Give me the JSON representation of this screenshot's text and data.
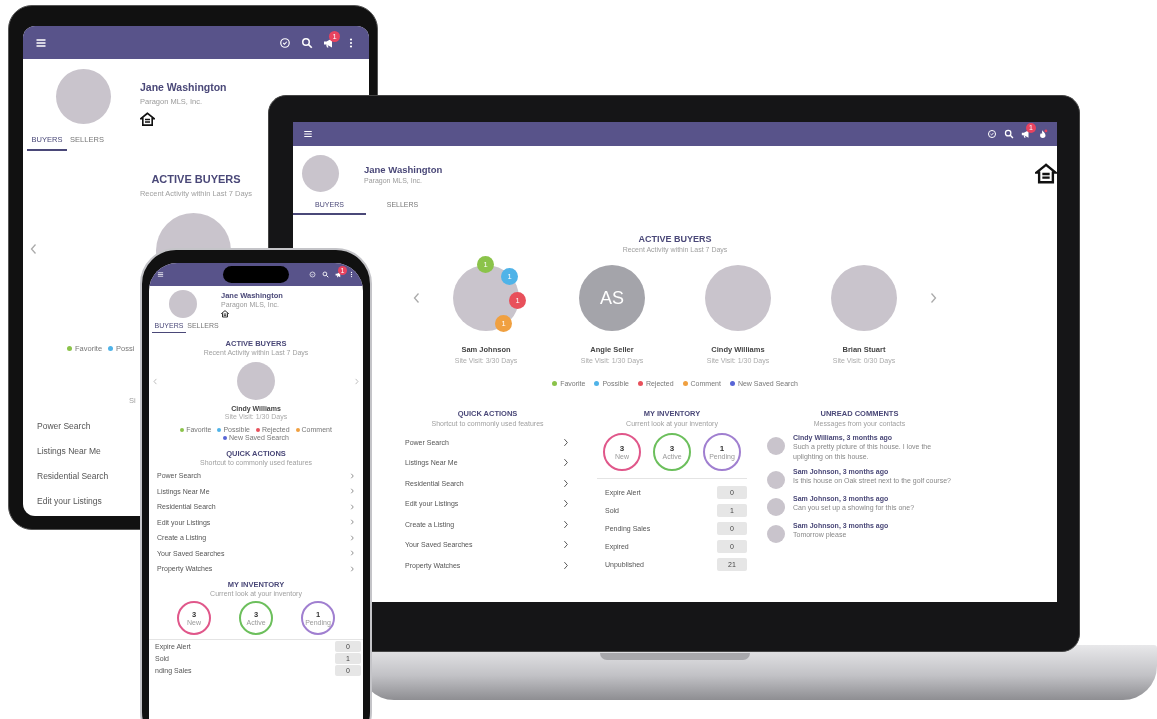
{
  "tablet": {
    "header": {
      "badge": "1"
    },
    "profile": {
      "name": "Jane Washington",
      "company": "Paragon MLS, Inc."
    },
    "tabs": [
      {
        "label": "BUYERS",
        "selected": true
      },
      {
        "label": "SELLERS",
        "selected": false
      }
    ],
    "active_buyers": {
      "title": "ACTIVE BUYERS",
      "subtitle": "Recent Activity within Last 7 Days"
    },
    "buyers": [
      {
        "kind": "photo"
      }
    ],
    "legend": [
      {
        "label": "Favorite",
        "color": "#8bc34a"
      },
      {
        "label": "Possi",
        "color": "#4fb3e8"
      }
    ],
    "quick_actions": {
      "subtitle": "Si",
      "items": [
        "Power Search",
        "Listings Near Me",
        "Residential Search",
        "Edit your Listings"
      ]
    }
  },
  "laptop": {
    "header": {
      "badge": "1"
    },
    "profile": {
      "name": "Jane Washington",
      "company": "Paragon MLS, Inc."
    },
    "tabs": [
      {
        "label": "BUYERS",
        "selected": true
      },
      {
        "label": "SELLERS",
        "selected": false
      }
    ],
    "active_buyers": {
      "title": "ACTIVE BUYERS",
      "subtitle": "Recent Activity within Last 7 Days"
    },
    "buyers": [
      {
        "kind": "photo",
        "name": "Sam Johnson",
        "visit": "Site Visit: 3/30 Days",
        "counts": [
          {
            "value": "1",
            "color": "#8bc34a"
          },
          {
            "value": "1",
            "color": "#4fb3e8"
          },
          {
            "value": "1",
            "color": "#e8505b"
          },
          {
            "value": "1",
            "color": "#f0a040"
          }
        ]
      },
      {
        "kind": "initials",
        "initials": "AS",
        "name": "Angie Seller",
        "visit": "Site Visit: 1/30 Days"
      },
      {
        "kind": "photo",
        "name": "Cindy Williams",
        "visit": "Site Visit: 1/30 Days"
      },
      {
        "kind": "photo",
        "name": "Brian Stuart",
        "visit": "Site Visit: 0/30 Days"
      }
    ],
    "legend": [
      {
        "label": "Favorite",
        "color": "#8bc34a"
      },
      {
        "label": "Possible",
        "color": "#4fb3e8"
      },
      {
        "label": "Rejected",
        "color": "#e8505b"
      },
      {
        "label": "Comment",
        "color": "#f0a040"
      },
      {
        "label": "New Saved Search",
        "color": "#5865d6"
      }
    ],
    "quick_actions": {
      "title": "QUICK ACTIONS",
      "subtitle": "Shortcut to commonly used features",
      "items": [
        "Power Search",
        "Listings Near Me",
        "Residential Search",
        "Edit your Listings",
        "Create a Listing",
        "Your Saved Searches",
        "Property Watches"
      ]
    },
    "inventory": {
      "title": "MY INVENTORY",
      "subtitle": "Current look at your inventory",
      "rings": [
        {
          "value": "3",
          "label": "New",
          "color": "#e0578a"
        },
        {
          "value": "3",
          "label": "Active",
          "color": "#6cbf5c"
        },
        {
          "value": "1",
          "label": "Pending",
          "color": "#a07fd0"
        }
      ],
      "rows": [
        {
          "label": "Expire Alert",
          "value": "0"
        },
        {
          "label": "Sold",
          "value": "1"
        },
        {
          "label": "Pending Sales",
          "value": "0"
        },
        {
          "label": "Expired",
          "value": "0"
        },
        {
          "label": "Unpublished",
          "value": "21"
        }
      ]
    },
    "comments": {
      "title": "UNREAD COMMENTS",
      "subtitle": "Messages from your contacts",
      "items": [
        {
          "author": "Cindy Williams, 3 months ago",
          "text": "Such a pretty picture of this house. I love the uplighting on this house."
        },
        {
          "author": "Sam Johnson, 3 months ago",
          "text": "Is this house on Oak street next to the golf course?"
        },
        {
          "author": "Sam Johnson, 3 months ago",
          "text": "Can you set up a showing for this one?"
        },
        {
          "author": "Sam Johnson, 3 months ago",
          "text": "Tomorrow please"
        }
      ]
    }
  },
  "phone": {
    "header": {
      "badge": "1"
    },
    "profile": {
      "name": "Jane Washington",
      "company": "Paragon MLS, Inc."
    },
    "tabs": [
      {
        "label": "BUYERS",
        "selected": true
      },
      {
        "label": "SELLERS",
        "selected": false
      }
    ],
    "active_buyers": {
      "title": "ACTIVE BUYERS",
      "subtitle": "Recent Activity within Last 7 Days"
    },
    "buyers": [
      {
        "kind": "photo",
        "name": "Cindy Williams",
        "visit": "Site Visit: 1/30 Days"
      }
    ],
    "legend": [
      {
        "label": "Favorite",
        "color": "#8bc34a"
      },
      {
        "label": "Possible",
        "color": "#4fb3e8"
      },
      {
        "label": "Rejected",
        "color": "#e8505b"
      },
      {
        "label": "Comment",
        "color": "#f0a040"
      },
      {
        "label": "New Saved Search",
        "color": "#5865d6"
      }
    ],
    "quick_actions": {
      "title": "QUICK ACTIONS",
      "subtitle": "Shortcut to commonly used features",
      "items": [
        "Power Search",
        "Listings Near Me",
        "Residential Search",
        "Edit your Listings",
        "Create a Listing",
        "Your Saved Searches",
        "Property Watches"
      ]
    },
    "inventory": {
      "title": "MY INVENTORY",
      "subtitle": "Current look at your inventory",
      "rings": [
        {
          "value": "3",
          "label": "New",
          "color": "#e0578a"
        },
        {
          "value": "3",
          "label": "Active",
          "color": "#6cbf5c"
        },
        {
          "value": "1",
          "label": "Pending",
          "color": "#a07fd0"
        }
      ],
      "rows": [
        {
          "label": "Expire Alert",
          "value": "0"
        },
        {
          "label": "Sold",
          "value": "1"
        },
        {
          "label": "nding Sales",
          "value": "0"
        }
      ]
    }
  }
}
